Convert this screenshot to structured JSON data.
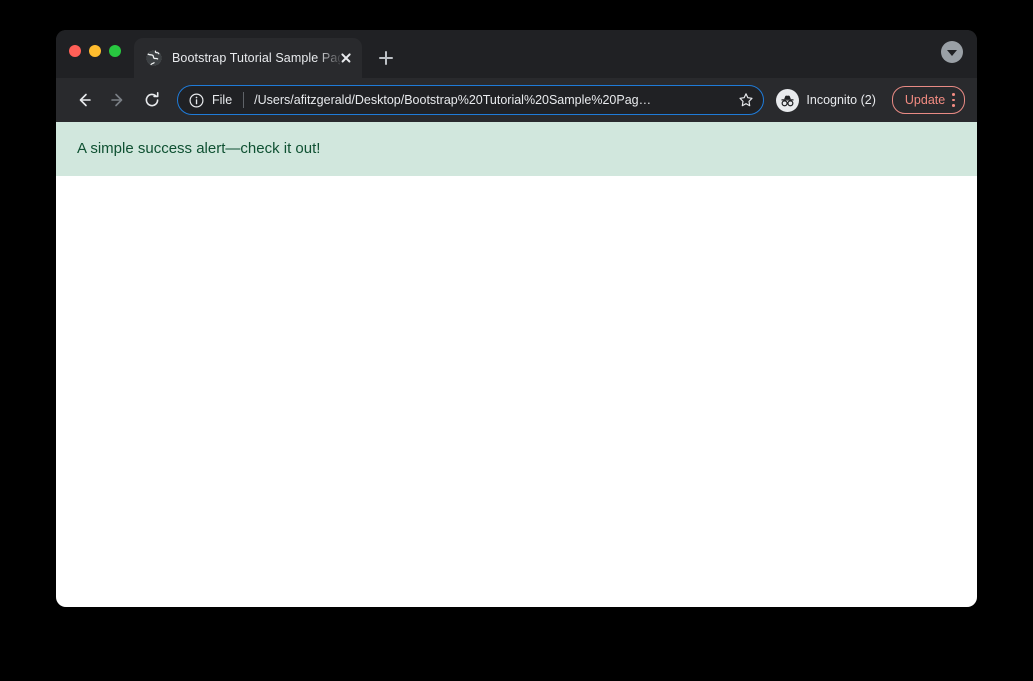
{
  "window": {
    "traffic_lights": [
      {
        "name": "close",
        "color": "#ff5f57"
      },
      {
        "name": "minimize",
        "color": "#febc2e"
      },
      {
        "name": "maximize",
        "color": "#28c840"
      }
    ]
  },
  "tab_strip": {
    "tabs": [
      {
        "title": "Bootstrap Tutorial Sample Page",
        "favicon": "globe-icon",
        "close_icon": "close-icon",
        "active": true
      }
    ],
    "new_tab_icon": "plus-icon",
    "tab_search_icon": "chevron-down-icon"
  },
  "toolbar": {
    "back_icon": "arrow-left-icon",
    "forward_icon": "arrow-right-icon",
    "reload_icon": "reload-icon",
    "omnibox": {
      "security_icon": "info-circle-icon",
      "scheme_label": "File",
      "url": "/Users/afitzgerald/Desktop/Bootstrap%20Tutorial%20Sample%20Pag…",
      "bookmark_icon": "star-icon"
    },
    "incognito": {
      "icon": "incognito-icon",
      "label": "Incognito (2)"
    },
    "update": {
      "label": "Update",
      "menu_icon": "three-dots-vertical-icon",
      "color": "#f28b82"
    }
  },
  "page": {
    "alert": {
      "text": "A simple success alert—check it out!",
      "background": "#d1e7dd",
      "text_color": "#0f5132"
    }
  }
}
